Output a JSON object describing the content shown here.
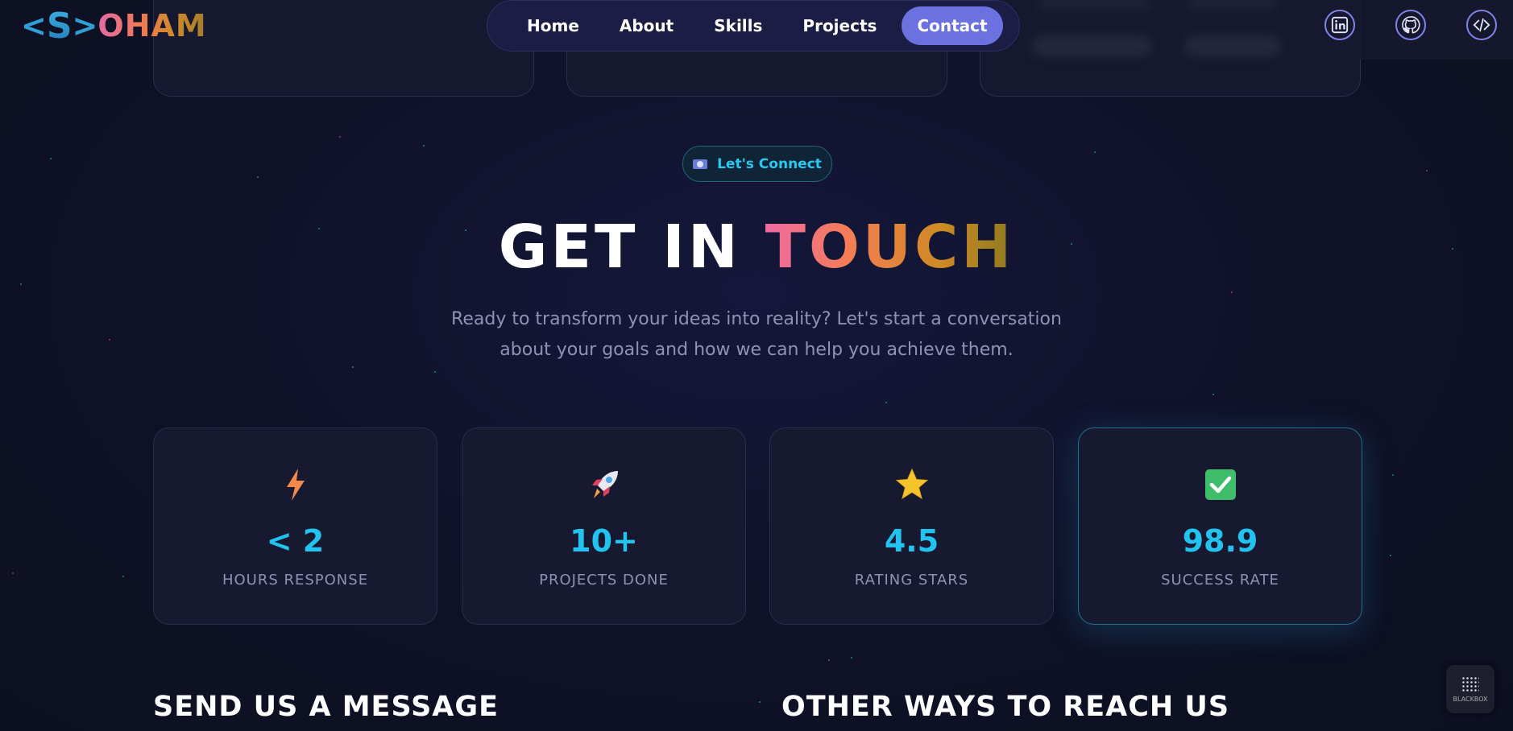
{
  "logo": {
    "bracket_left": "<",
    "s": "S",
    "bracket_right": ">",
    "rest": "OHAM"
  },
  "nav": {
    "items": [
      "Home",
      "About",
      "Skills",
      "Projects",
      "Contact"
    ],
    "active": "Contact"
  },
  "social": [
    {
      "icon": "linkedin-icon",
      "glyph": "in"
    },
    {
      "icon": "github-icon",
      "glyph": "⌥"
    },
    {
      "icon": "code-icon",
      "glyph": "</>"
    }
  ],
  "badge": {
    "icon": "camera-icon",
    "text": "Let's Connect"
  },
  "title": {
    "word1": "GET IN",
    "word2": "TOUCH"
  },
  "subtitle": "Ready to transform your ideas into reality? Let's start a conversation about your goals and how we can help you achieve them.",
  "stats": [
    {
      "icon": "lightning-icon",
      "value": "< 2",
      "label": "HOURS RESPONSE"
    },
    {
      "icon": "rocket-icon",
      "value": "10+",
      "label": "PROJECTS DONE"
    },
    {
      "icon": "star-icon",
      "value": "4.5",
      "label": "RATING STARS"
    },
    {
      "icon": "check-icon",
      "value": "98.9",
      "label": "SUCCESS RATE"
    }
  ],
  "sections": {
    "message": "SEND US A MESSAGE",
    "other": "OTHER WAYS TO REACH US"
  },
  "blackbox": {
    "label": "BLACKBOX"
  },
  "colors": {
    "background": "#0f1126",
    "accent": "#22c3ee",
    "nav_active": "#6b71e0",
    "card_border": "#2a2e4c"
  }
}
